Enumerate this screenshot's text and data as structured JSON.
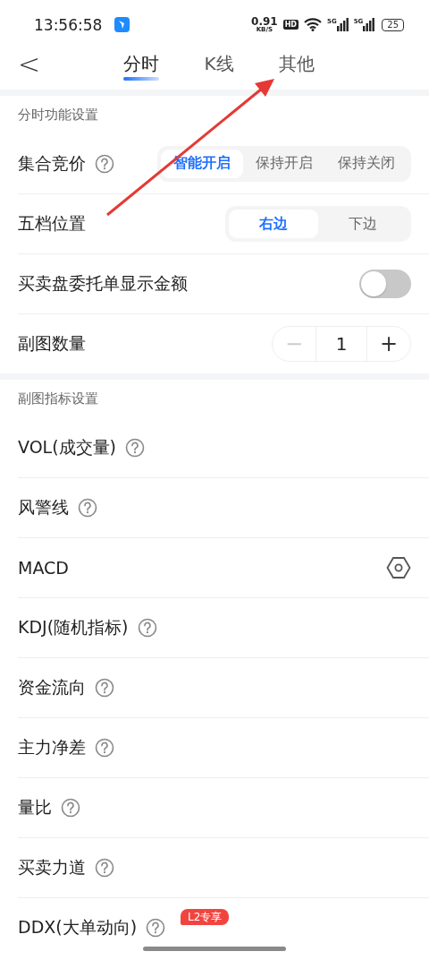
{
  "status_bar": {
    "time": "13:56:58",
    "speed": "0.91",
    "speed_unit": "KB/S",
    "hd": "HD",
    "network_1": "5G",
    "network_2": "5G",
    "battery": "25"
  },
  "header": {
    "back": "<",
    "tabs": [
      {
        "label": "分时",
        "selected": true
      },
      {
        "label": "K线",
        "selected": false
      },
      {
        "label": "其他",
        "selected": false
      }
    ]
  },
  "sections": [
    {
      "title": "分时功能设置",
      "rows": [
        {
          "kind": "segmented",
          "label": "集合竞价",
          "help": true,
          "options": [
            {
              "label": "智能开启",
              "selected": true
            },
            {
              "label": "保持开启",
              "selected": false
            },
            {
              "label": "保持关闭",
              "selected": false
            }
          ]
        },
        {
          "kind": "segmented",
          "label": "五档位置",
          "help": false,
          "options": [
            {
              "label": "右边",
              "selected": true
            },
            {
              "label": "下边",
              "selected": false
            }
          ]
        },
        {
          "kind": "toggle",
          "label": "买卖盘委托单显示金额",
          "help": false,
          "on": false
        },
        {
          "kind": "stepper",
          "label": "副图数量",
          "help": false,
          "minus": "−",
          "value": "1",
          "plus": "+",
          "minus_disabled": true
        }
      ]
    },
    {
      "title": "副图指标设置",
      "rows": [
        {
          "kind": "plain",
          "label": "VOL(成交量)",
          "help": true
        },
        {
          "kind": "plain",
          "label": "风警线",
          "help": true
        },
        {
          "kind": "settings",
          "label": "MACD",
          "help": false
        },
        {
          "kind": "plain",
          "label": "KDJ(随机指标)",
          "help": true
        },
        {
          "kind": "plain",
          "label": "资金流向",
          "help": true
        },
        {
          "kind": "plain",
          "label": "主力净差",
          "help": true
        },
        {
          "kind": "plain",
          "label": "量比",
          "help": true
        },
        {
          "kind": "plain",
          "label": "买卖力道",
          "help": true
        },
        {
          "kind": "plain",
          "label": "DDX(大单动向)",
          "help": true,
          "badge": "L2专享"
        }
      ]
    }
  ],
  "annotation": {
    "kind": "arrow"
  }
}
